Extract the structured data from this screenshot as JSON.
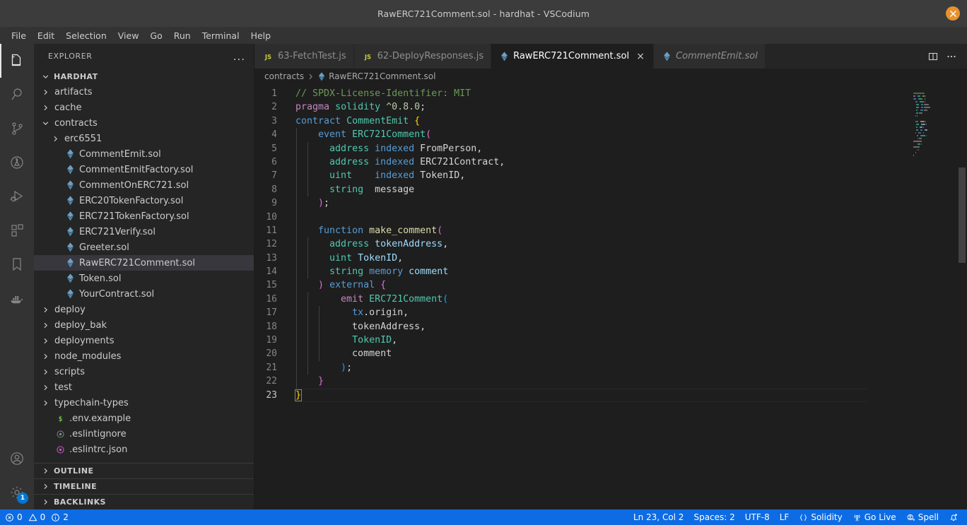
{
  "window": {
    "title": "RawERC721Comment.sol - hardhat - VSCodium",
    "close_icon": "close-icon"
  },
  "menubar": {
    "items": [
      "File",
      "Edit",
      "Selection",
      "View",
      "Go",
      "Run",
      "Terminal",
      "Help"
    ]
  },
  "activitybar": {
    "top_icons": [
      {
        "name": "explorer-icon",
        "active": true
      },
      {
        "name": "search-icon",
        "active": false
      },
      {
        "name": "source-control-icon",
        "active": false
      },
      {
        "name": "testing-icon",
        "active": false
      },
      {
        "name": "run-and-debug-icon",
        "active": false
      },
      {
        "name": "extensions-icon",
        "active": false
      },
      {
        "name": "bookmarks-icon",
        "active": false
      },
      {
        "name": "docker-icon",
        "active": false
      }
    ],
    "bottom_icons": [
      {
        "name": "accounts-icon",
        "badge": ""
      },
      {
        "name": "manage-settings-icon",
        "badge": "1"
      }
    ]
  },
  "sidebar": {
    "title": "EXPLORER",
    "more_actions": "...",
    "root": "HARDHAT",
    "items": [
      {
        "label": "artifacts",
        "type": "folder",
        "indent": 1,
        "expanded": false
      },
      {
        "label": "cache",
        "type": "folder",
        "indent": 1,
        "expanded": false
      },
      {
        "label": "contracts",
        "type": "folder",
        "indent": 1,
        "expanded": true
      },
      {
        "label": "erc6551",
        "type": "folder",
        "indent": 2,
        "expanded": false
      },
      {
        "label": "CommentEmit.sol",
        "type": "sol",
        "indent": 2
      },
      {
        "label": "CommentEmitFactory.sol",
        "type": "sol",
        "indent": 2
      },
      {
        "label": "CommentOnERC721.sol",
        "type": "sol",
        "indent": 2
      },
      {
        "label": "ERC20TokenFactory.sol",
        "type": "sol",
        "indent": 2
      },
      {
        "label": "ERC721TokenFactory.sol",
        "type": "sol",
        "indent": 2
      },
      {
        "label": "ERC721Verify.sol",
        "type": "sol",
        "indent": 2
      },
      {
        "label": "Greeter.sol",
        "type": "sol",
        "indent": 2
      },
      {
        "label": "RawERC721Comment.sol",
        "type": "sol",
        "indent": 2,
        "selected": true
      },
      {
        "label": "Token.sol",
        "type": "sol",
        "indent": 2
      },
      {
        "label": "YourContract.sol",
        "type": "sol",
        "indent": 2
      },
      {
        "label": "deploy",
        "type": "folder",
        "indent": 1,
        "expanded": false
      },
      {
        "label": "deploy_bak",
        "type": "folder",
        "indent": 1,
        "expanded": false
      },
      {
        "label": "deployments",
        "type": "folder",
        "indent": 1,
        "expanded": false
      },
      {
        "label": "node_modules",
        "type": "folder",
        "indent": 1,
        "expanded": false
      },
      {
        "label": "scripts",
        "type": "folder",
        "indent": 1,
        "expanded": false
      },
      {
        "label": "test",
        "type": "folder",
        "indent": 1,
        "expanded": false
      },
      {
        "label": "typechain-types",
        "type": "folder",
        "indent": 1,
        "expanded": false
      },
      {
        "label": ".env.example",
        "type": "env",
        "indent": 1
      },
      {
        "label": ".eslintignore",
        "type": "eslintignore",
        "indent": 1
      },
      {
        "label": ".eslintrc.json",
        "type": "eslintrc",
        "indent": 1
      }
    ],
    "panels": [
      "OUTLINE",
      "TIMELINE",
      "BACKLINKS"
    ]
  },
  "tabs": [
    {
      "label": "63-FetchTest.js",
      "icon": "js-icon",
      "active": false,
      "preview": false,
      "closable": false
    },
    {
      "label": "62-DeployResponses.js",
      "icon": "js-icon",
      "active": false,
      "preview": false,
      "closable": false
    },
    {
      "label": "RawERC721Comment.sol",
      "icon": "sol-icon",
      "active": true,
      "preview": false,
      "closable": true,
      "close_label": "×"
    },
    {
      "label": "CommentEmit.sol",
      "icon": "sol-icon",
      "active": false,
      "preview": true,
      "closable": false
    }
  ],
  "editor_actions": [
    {
      "name": "split-editor-right-icon"
    },
    {
      "name": "more-actions-icon",
      "label": "···"
    }
  ],
  "breadcrumbs": [
    {
      "label": "contracts",
      "icon": ""
    },
    {
      "label": "RawERC721Comment.sol",
      "icon": "sol-icon"
    }
  ],
  "code": {
    "language": "solidity",
    "cursor_line": 23,
    "lines": [
      {
        "n": 1,
        "indents": 0,
        "tokens": [
          {
            "t": "// SPDX-License-Identifier: MIT",
            "c": "t-com"
          }
        ]
      },
      {
        "n": 2,
        "indents": 0,
        "tokens": [
          {
            "t": "pragma",
            "c": "t-kw"
          },
          {
            "t": " ",
            "c": "t-pl"
          },
          {
            "t": "solidity",
            "c": "t-type"
          },
          {
            "t": " ",
            "c": "t-pl"
          },
          {
            "t": "^0.8.0",
            "c": "t-num"
          },
          {
            "t": ";",
            "c": "t-pl"
          }
        ]
      },
      {
        "n": 3,
        "indents": 0,
        "tokens": [
          {
            "t": "contract",
            "c": "t-kw2"
          },
          {
            "t": " ",
            "c": "t-pl"
          },
          {
            "t": "CommentEmit",
            "c": "t-type"
          },
          {
            "t": " ",
            "c": "t-pl"
          },
          {
            "t": "{",
            "c": "t-br1"
          }
        ]
      },
      {
        "n": 4,
        "indents": 1,
        "tokens": [
          {
            "t": "    ",
            "c": "t-pl"
          },
          {
            "t": "event",
            "c": "t-kw2"
          },
          {
            "t": " ",
            "c": "t-pl"
          },
          {
            "t": "ERC721Comment",
            "c": "t-type"
          },
          {
            "t": "(",
            "c": "t-br2"
          }
        ]
      },
      {
        "n": 5,
        "indents": 2,
        "tokens": [
          {
            "t": "      ",
            "c": "t-pl"
          },
          {
            "t": "address",
            "c": "t-type"
          },
          {
            "t": " ",
            "c": "t-pl"
          },
          {
            "t": "indexed",
            "c": "t-kw2"
          },
          {
            "t": " FromPerson,",
            "c": "t-pl"
          }
        ]
      },
      {
        "n": 6,
        "indents": 2,
        "tokens": [
          {
            "t": "      ",
            "c": "t-pl"
          },
          {
            "t": "address",
            "c": "t-type"
          },
          {
            "t": " ",
            "c": "t-pl"
          },
          {
            "t": "indexed",
            "c": "t-kw2"
          },
          {
            "t": " ERC721Contract,",
            "c": "t-pl"
          }
        ]
      },
      {
        "n": 7,
        "indents": 2,
        "tokens": [
          {
            "t": "      ",
            "c": "t-pl"
          },
          {
            "t": "uint",
            "c": "t-type"
          },
          {
            "t": "    ",
            "c": "t-pl"
          },
          {
            "t": "indexed",
            "c": "t-kw2"
          },
          {
            "t": " TokenID,",
            "c": "t-pl"
          }
        ]
      },
      {
        "n": 8,
        "indents": 2,
        "tokens": [
          {
            "t": "      ",
            "c": "t-pl"
          },
          {
            "t": "string",
            "c": "t-type"
          },
          {
            "t": "  message",
            "c": "t-pl"
          }
        ]
      },
      {
        "n": 9,
        "indents": 1,
        "tokens": [
          {
            "t": "    ",
            "c": "t-pl"
          },
          {
            "t": ")",
            "c": "t-br2"
          },
          {
            "t": ";",
            "c": "t-pl"
          }
        ]
      },
      {
        "n": 10,
        "indents": 1,
        "tokens": []
      },
      {
        "n": 11,
        "indents": 1,
        "tokens": [
          {
            "t": "    ",
            "c": "t-pl"
          },
          {
            "t": "function",
            "c": "t-kw2"
          },
          {
            "t": " ",
            "c": "t-pl"
          },
          {
            "t": "make_comment",
            "c": "t-fn"
          },
          {
            "t": "(",
            "c": "t-br2"
          }
        ]
      },
      {
        "n": 12,
        "indents": 2,
        "tokens": [
          {
            "t": "      ",
            "c": "t-pl"
          },
          {
            "t": "address",
            "c": "t-type"
          },
          {
            "t": " ",
            "c": "t-pl"
          },
          {
            "t": "tokenAddress",
            "c": "t-var"
          },
          {
            "t": ",",
            "c": "t-pl"
          }
        ]
      },
      {
        "n": 13,
        "indents": 2,
        "tokens": [
          {
            "t": "      ",
            "c": "t-pl"
          },
          {
            "t": "uint",
            "c": "t-type"
          },
          {
            "t": " ",
            "c": "t-pl"
          },
          {
            "t": "TokenID",
            "c": "t-var"
          },
          {
            "t": ",",
            "c": "t-pl"
          }
        ]
      },
      {
        "n": 14,
        "indents": 2,
        "tokens": [
          {
            "t": "      ",
            "c": "t-pl"
          },
          {
            "t": "string",
            "c": "t-type"
          },
          {
            "t": " ",
            "c": "t-pl"
          },
          {
            "t": "memory",
            "c": "t-kw2"
          },
          {
            "t": " ",
            "c": "t-pl"
          },
          {
            "t": "comment",
            "c": "t-var"
          }
        ]
      },
      {
        "n": 15,
        "indents": 1,
        "tokens": [
          {
            "t": "    ",
            "c": "t-pl"
          },
          {
            "t": ")",
            "c": "t-br2"
          },
          {
            "t": " ",
            "c": "t-pl"
          },
          {
            "t": "external",
            "c": "t-kw2"
          },
          {
            "t": " ",
            "c": "t-pl"
          },
          {
            "t": "{",
            "c": "t-br2"
          }
        ]
      },
      {
        "n": 16,
        "indents": 2,
        "tokens": [
          {
            "t": "        ",
            "c": "t-pl"
          },
          {
            "t": "emit",
            "c": "t-kw"
          },
          {
            "t": " ",
            "c": "t-pl"
          },
          {
            "t": "ERC721Comment",
            "c": "t-type"
          },
          {
            "t": "(",
            "c": "t-br3"
          }
        ]
      },
      {
        "n": 17,
        "indents": 3,
        "tokens": [
          {
            "t": "          ",
            "c": "t-pl"
          },
          {
            "t": "tx",
            "c": "t-kw2"
          },
          {
            "t": ".origin,",
            "c": "t-pl"
          }
        ]
      },
      {
        "n": 18,
        "indents": 3,
        "tokens": [
          {
            "t": "          tokenAddress,",
            "c": "t-pl"
          }
        ]
      },
      {
        "n": 19,
        "indents": 3,
        "tokens": [
          {
            "t": "          ",
            "c": "t-pl"
          },
          {
            "t": "TokenID",
            "c": "t-type"
          },
          {
            "t": ",",
            "c": "t-pl"
          }
        ]
      },
      {
        "n": 20,
        "indents": 3,
        "tokens": [
          {
            "t": "          comment",
            "c": "t-pl"
          }
        ]
      },
      {
        "n": 21,
        "indents": 2,
        "tokens": [
          {
            "t": "        ",
            "c": "t-pl"
          },
          {
            "t": ")",
            "c": "t-br3"
          },
          {
            "t": ";",
            "c": "t-pl"
          }
        ]
      },
      {
        "n": 22,
        "indents": 1,
        "tokens": [
          {
            "t": "    ",
            "c": "t-pl"
          },
          {
            "t": "}",
            "c": "t-br2"
          }
        ]
      },
      {
        "n": 23,
        "indents": 0,
        "current": true,
        "tokens": [
          {
            "t": "}",
            "c": "t-br1",
            "cursor": true
          }
        ]
      }
    ]
  },
  "statusbar": {
    "left": [
      {
        "name": "problems",
        "error_icon": "error-circle-icon",
        "error_count": "0",
        "warn_icon": "warning-triangle-icon",
        "warn_count": "0",
        "info_icon": "info-circle-icon",
        "info_count": "2"
      }
    ],
    "right": [
      {
        "name": "editor-position",
        "label": "Ln 23, Col 2",
        "icon": ""
      },
      {
        "name": "indentation",
        "label": "Spaces: 2",
        "icon": ""
      },
      {
        "name": "encoding",
        "label": "UTF-8",
        "icon": ""
      },
      {
        "name": "eol",
        "label": "LF",
        "icon": ""
      },
      {
        "name": "language-mode",
        "label": "Solidity",
        "icon": "braces-icon"
      },
      {
        "name": "go-live",
        "label": "Go Live",
        "icon": "broadcast-icon"
      },
      {
        "name": "spell-checker",
        "label": "Spell",
        "icon": "spell-icon"
      },
      {
        "name": "notifications",
        "label": "",
        "icon": "bell-dot-icon"
      }
    ]
  },
  "colors": {
    "accent": "#0d6ce4",
    "titlebar_bg": "#3c3c3c",
    "sidebar_bg": "#252526",
    "editor_bg": "#1e1e1e",
    "close_button": "#e8912d",
    "sol_icon": "#519aba",
    "js_icon": "#cbcb41",
    "selection": "#37373d"
  }
}
